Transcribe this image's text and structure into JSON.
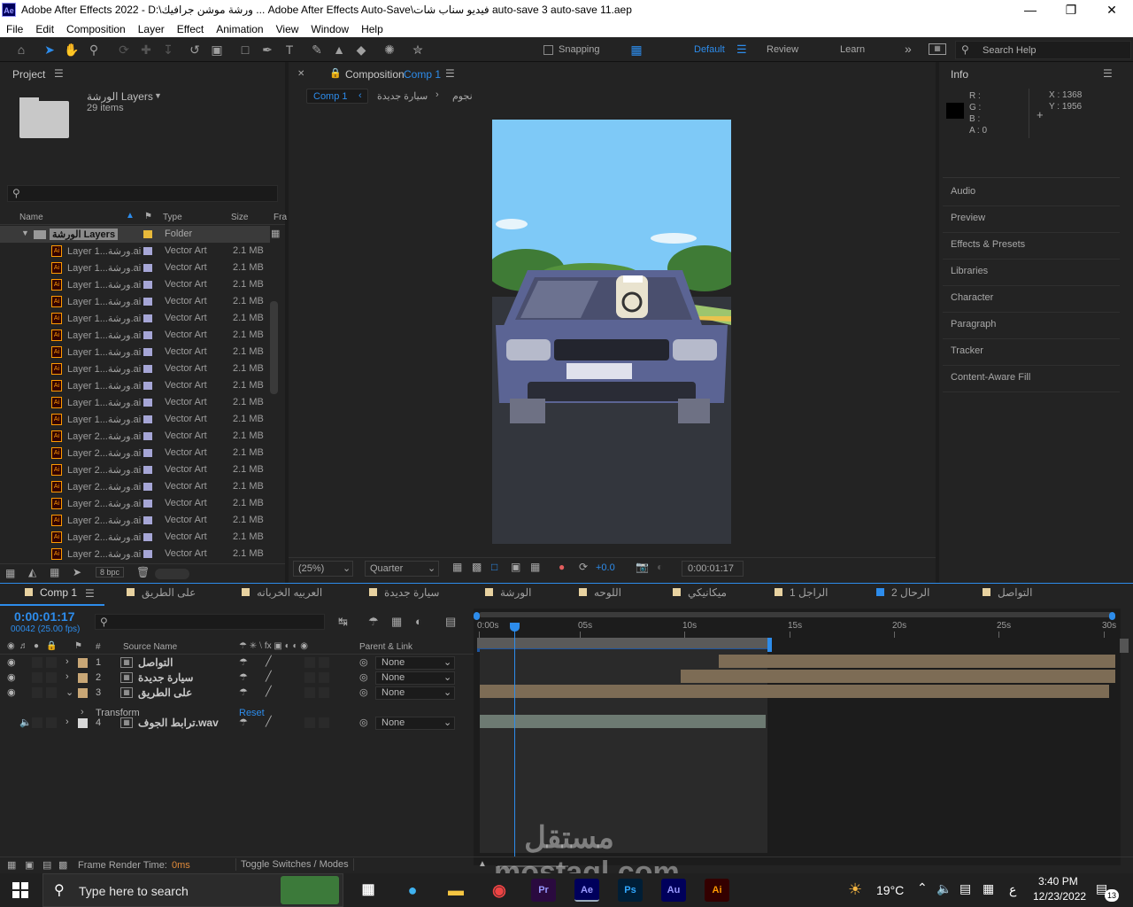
{
  "window": {
    "title": "Adobe After Effects 2022 - D:\\ورشة موشن جرافيك ... Adobe After Effects Auto-Save\\فيديو سناب شات auto-save 3 auto-save 11.aep",
    "app_icon": "Ae"
  },
  "menu": [
    "File",
    "Edit",
    "Composition",
    "Layer",
    "Effect",
    "Animation",
    "View",
    "Window",
    "Help"
  ],
  "toolbar": {
    "snapping": "Snapping",
    "workspaces": [
      "Default",
      "Review",
      "Learn"
    ],
    "search_placeholder": "Search Help"
  },
  "project": {
    "title": "Project",
    "folder_name": "الورشة Layers",
    "items_count": "29 items",
    "columns": [
      "Name",
      "Type",
      "Size",
      "Fra"
    ],
    "folder_row": {
      "name": "الورشة Layers",
      "type": "Folder"
    },
    "rows": [
      {
        "name": "Layer 1...ورشة.ai",
        "type": "Vector Art",
        "size": "2.1 MB"
      },
      {
        "name": "Layer 1...ورشة.ai",
        "type": "Vector Art",
        "size": "2.1 MB"
      },
      {
        "name": "Layer 1...ورشة.ai",
        "type": "Vector Art",
        "size": "2.1 MB"
      },
      {
        "name": "Layer 1...ورشة.ai",
        "type": "Vector Art",
        "size": "2.1 MB"
      },
      {
        "name": "Layer 1...ورشة.ai",
        "type": "Vector Art",
        "size": "2.1 MB"
      },
      {
        "name": "Layer 1...ورشة.ai",
        "type": "Vector Art",
        "size": "2.1 MB"
      },
      {
        "name": "Layer 1...ورشة.ai",
        "type": "Vector Art",
        "size": "2.1 MB"
      },
      {
        "name": "Layer 1...ورشة.ai",
        "type": "Vector Art",
        "size": "2.1 MB"
      },
      {
        "name": "Layer 1...ورشة.ai",
        "type": "Vector Art",
        "size": "2.1 MB"
      },
      {
        "name": "Layer 1...ورشة.ai",
        "type": "Vector Art",
        "size": "2.1 MB"
      },
      {
        "name": "Layer 1...ورشة.ai",
        "type": "Vector Art",
        "size": "2.1 MB"
      },
      {
        "name": "Layer 2...ورشة.ai",
        "type": "Vector Art",
        "size": "2.1 MB"
      },
      {
        "name": "Layer 2...ورشة.ai",
        "type": "Vector Art",
        "size": "2.1 MB"
      },
      {
        "name": "Layer 2...ورشة.ai",
        "type": "Vector Art",
        "size": "2.1 MB"
      },
      {
        "name": "Layer 2...ورشة.ai",
        "type": "Vector Art",
        "size": "2.1 MB"
      },
      {
        "name": "Layer 2...ورشة.ai",
        "type": "Vector Art",
        "size": "2.1 MB"
      },
      {
        "name": "Layer 2...ورشة.ai",
        "type": "Vector Art",
        "size": "2.1 MB"
      },
      {
        "name": "Layer 2...ورشة.ai",
        "type": "Vector Art",
        "size": "2.1 MB"
      },
      {
        "name": "Layer 2...ورشة.ai",
        "type": "Vector Art",
        "size": "2.1 MB"
      }
    ],
    "bpc": "8 bpc"
  },
  "composition": {
    "title": "Composition",
    "comp_name": "Comp 1",
    "breadcrumbs": [
      "Comp 1",
      "سيارة جديدة",
      "نجوم"
    ],
    "zoom": "(25%)",
    "resolution": "Quarter",
    "exposure": "+0.0",
    "timecode": "0:00:01:17"
  },
  "info": {
    "title": "Info",
    "r": "R :",
    "g": "G :",
    "b": "B :",
    "a": "A : 0",
    "x": "X : 1368",
    "y": "Y : 1956",
    "panels": [
      "Audio",
      "Preview",
      "Effects & Presets",
      "Libraries",
      "Character",
      "Paragraph",
      "Tracker",
      "Content-Aware Fill"
    ]
  },
  "timeline": {
    "tabs": [
      "Comp 1",
      "على الطريق",
      "العربيه الخربانه",
      "سيارة جديدة",
      "الورشة",
      "اللوحه",
      "ميكانيكي",
      "الراجل 1",
      "الرحال 2",
      "التواصل"
    ],
    "tab_colors": [
      "#e8d2a0",
      "#e8d2a0",
      "#e8d2a0",
      "#e8d2a0",
      "#e8d2a0",
      "#e8d2a0",
      "#e8d2a0",
      "#e8d2a0",
      "#2d8ceb",
      "#e8d2a0"
    ],
    "timecode": "0:00:01:17",
    "frames": "00042 (25.00 fps)",
    "headers": {
      "source": "Source Name",
      "parent": "Parent & Link"
    },
    "ruler": [
      "0:00s",
      "05s",
      "10s",
      "15s",
      "20s",
      "25s",
      "30s"
    ],
    "layers": [
      {
        "num": "1",
        "name": "التواصل",
        "parent": "None"
      },
      {
        "num": "2",
        "name": "سيارة جديدة",
        "parent": "None"
      },
      {
        "num": "3",
        "name": "على الطريق",
        "parent": "None"
      },
      {
        "num": "4",
        "name": "ترابط الجوف.wav",
        "parent": "None"
      }
    ],
    "transform": "Transform",
    "reset": "Reset",
    "footer": {
      "render": "Frame Render Time:",
      "render_val": "0ms",
      "toggle": "Toggle Switches / Modes"
    }
  },
  "taskbar": {
    "search": "Type here to search",
    "temp": "19°C",
    "time": "3:40 PM",
    "date": "12/23/2022",
    "notif": "13",
    "lang": "ع"
  },
  "watermark": "مستقل mostaql.com"
}
